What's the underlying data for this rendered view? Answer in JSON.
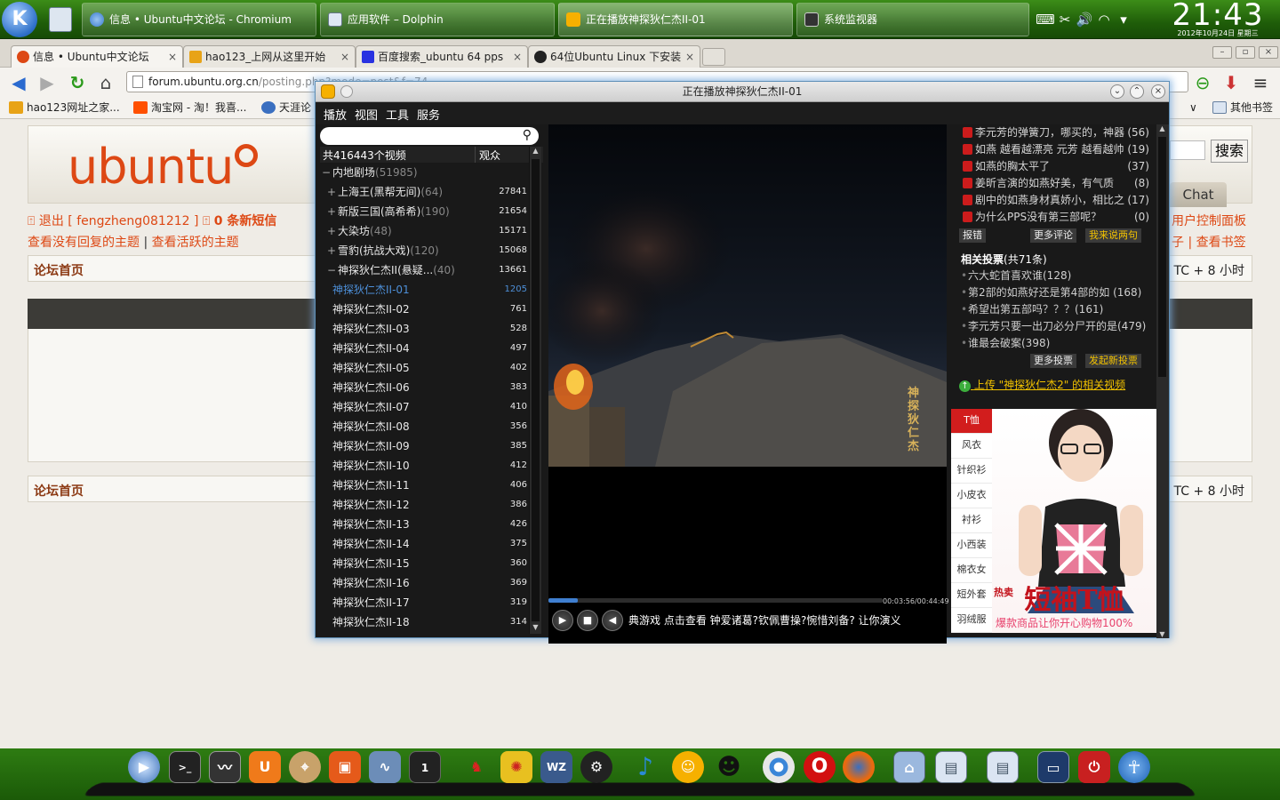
{
  "panel": {
    "kmenu_label": "K",
    "tasks": [
      {
        "label": "信息 • Ubuntu中文论坛 - Chromium",
        "icon": "chromium-icon"
      },
      {
        "label": "应用软件 – Dolphin",
        "icon": "dolphin-icon"
      },
      {
        "label": "正在播放神探狄仁杰II-01",
        "icon": "pps-icon"
      },
      {
        "label": "系统监视器",
        "icon": "monitor-icon"
      }
    ],
    "clock": {
      "time": "21:43",
      "date": "2012年10月24日 星期三"
    }
  },
  "browser": {
    "tabs": [
      {
        "label": "信息 • Ubuntu中文论坛",
        "close": "×"
      },
      {
        "label": "hao123_上网从这里开始",
        "close": "×"
      },
      {
        "label": "百度搜索_ubuntu 64 pps",
        "close": "×"
      },
      {
        "label": "64位Ubuntu Linux 下安装",
        "close": "×"
      }
    ],
    "url_host": "forum.ubuntu.org.cn",
    "url_path": "/posting.php?mode=post&f=74",
    "bookmarks": [
      "hao123网址之家...",
      "淘宝网 - 淘！我喜...",
      "天涯论"
    ],
    "other_bookmarks": "其他书签"
  },
  "forum": {
    "logo": "ubuntu",
    "search_button": "搜索",
    "chat_button": "Chat",
    "logout": "退出 [ fengzheng081212 ]",
    "new_messages": "0 条新短信",
    "unanswered": "查看没有回复的主题",
    "active": "查看活跃的主题",
    "control_panel": "用户控制面板",
    "bookmarks_link": "子 | 查看书签",
    "breadcrumb": "论坛首页",
    "timezone": "TC + 8 小时"
  },
  "player": {
    "title": "正在播放神探狄仁杰II-01",
    "menu": [
      "播放",
      "视图",
      "工具",
      "服务"
    ],
    "total": "共416443个视频",
    "audience_col": "观众",
    "list": [
      {
        "label": "内地剧场",
        "sub": "(51985)",
        "count": "",
        "type": "cat"
      },
      {
        "label": "上海王(黑帮无间)",
        "sub": "(64)",
        "count": "27841",
        "type": "show"
      },
      {
        "label": "新版三国(高希希)",
        "sub": "(190)",
        "count": "21654",
        "type": "show"
      },
      {
        "label": "大染坊",
        "sub": "(48)",
        "count": "15171",
        "type": "show"
      },
      {
        "label": "雪豹(抗战大戏)",
        "sub": "(120)",
        "count": "15068",
        "type": "show"
      },
      {
        "label": "神探狄仁杰II(悬疑...",
        "sub": "(40)",
        "count": "13661",
        "type": "open"
      },
      {
        "label": "神探狄仁杰II-01",
        "sub": "",
        "count": "1205",
        "type": "ep",
        "playing": true
      },
      {
        "label": "神探狄仁杰II-02",
        "sub": "",
        "count": "761",
        "type": "ep"
      },
      {
        "label": "神探狄仁杰II-03",
        "sub": "",
        "count": "528",
        "type": "ep"
      },
      {
        "label": "神探狄仁杰II-04",
        "sub": "",
        "count": "497",
        "type": "ep"
      },
      {
        "label": "神探狄仁杰II-05",
        "sub": "",
        "count": "402",
        "type": "ep"
      },
      {
        "label": "神探狄仁杰II-06",
        "sub": "",
        "count": "383",
        "type": "ep"
      },
      {
        "label": "神探狄仁杰II-07",
        "sub": "",
        "count": "410",
        "type": "ep"
      },
      {
        "label": "神探狄仁杰II-08",
        "sub": "",
        "count": "356",
        "type": "ep"
      },
      {
        "label": "神探狄仁杰II-09",
        "sub": "",
        "count": "385",
        "type": "ep"
      },
      {
        "label": "神探狄仁杰II-10",
        "sub": "",
        "count": "412",
        "type": "ep"
      },
      {
        "label": "神探狄仁杰II-11",
        "sub": "",
        "count": "406",
        "type": "ep"
      },
      {
        "label": "神探狄仁杰II-12",
        "sub": "",
        "count": "386",
        "type": "ep"
      },
      {
        "label": "神探狄仁杰II-13",
        "sub": "",
        "count": "426",
        "type": "ep"
      },
      {
        "label": "神探狄仁杰II-14",
        "sub": "",
        "count": "375",
        "type": "ep"
      },
      {
        "label": "神探狄仁杰II-15",
        "sub": "",
        "count": "360",
        "type": "ep"
      },
      {
        "label": "神探狄仁杰II-16",
        "sub": "",
        "count": "369",
        "type": "ep"
      },
      {
        "label": "神探狄仁杰II-17",
        "sub": "",
        "count": "319",
        "type": "ep"
      },
      {
        "label": "神探狄仁杰II-18",
        "sub": "",
        "count": "314",
        "type": "ep"
      }
    ],
    "video_caption": "神探狄仁杰",
    "elapsed": "00:03:56",
    "duration": "00:44:49",
    "progress_fraction": 0.088,
    "ticker": "典游戏 点击查看    钟爱诸葛?钦佩曹操?惋惜刘备?    让你演义",
    "comments": [
      {
        "text": "李元芳的弹簧刀，哪买的，神器",
        "n": "(56)"
      },
      {
        "text": "如燕 越看越漂亮 元芳 越看越帅",
        "n": "(19)"
      },
      {
        "text": "如燕的胸太平了",
        "n": "(37)"
      },
      {
        "text": "姜昕言演的如燕好美，有气质",
        "n": "(8)"
      },
      {
        "text": "剧中的如燕身材真娇小，相比之",
        "n": "(17)"
      },
      {
        "text": "为什么PPS没有第三部呢？",
        "n": "(0)"
      }
    ],
    "btn_report": "报错",
    "btn_more_comments": "更多评论",
    "btn_say": "我来说两句",
    "votes_title": "相关投票",
    "votes_count": "(共71条)",
    "votes": [
      "六大蛇首喜欢谁(128)",
      "第2部的如燕好还是第4部的如 (168)",
      "希望出第五部吗？？？(161)",
      "李元芳只要一出刀必分尸开的是(479)",
      "谁最会破案(398)"
    ],
    "btn_more_votes": "更多投票",
    "btn_new_vote": "发起新投票",
    "upload": "上传 \"神探狄仁杰2\" 的相关视频",
    "ad_cats": [
      "T恤",
      "风衣",
      "针织衫",
      "小皮衣",
      "衬衫",
      "小西装",
      "棉衣女",
      "短外套",
      "羽绒服"
    ],
    "ad_title": "短袖T恤",
    "ad_sub": "爆款商品让你开心购物100%",
    "ad_hot": "热卖"
  }
}
